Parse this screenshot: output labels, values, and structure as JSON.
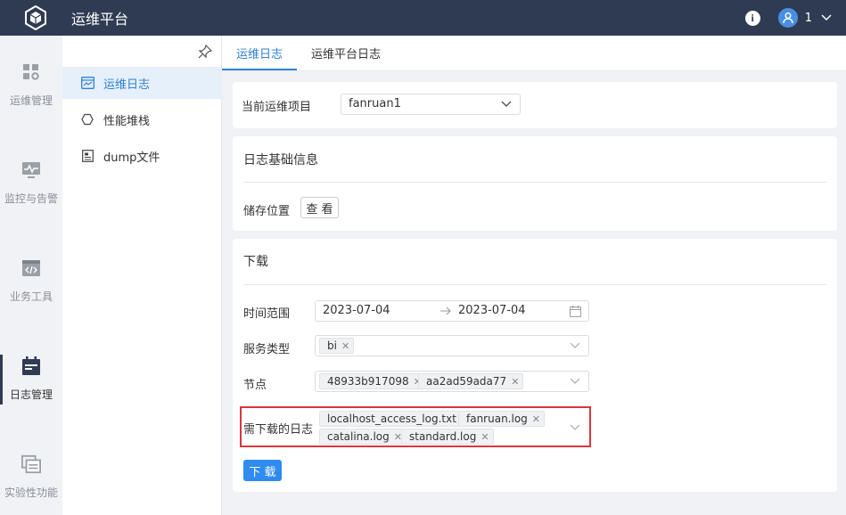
{
  "header": {
    "title": "运维平台",
    "user": "1"
  },
  "rail": {
    "items": [
      {
        "label": "运维管理",
        "icon": "grid-gear-icon"
      },
      {
        "label": "监控与告警",
        "icon": "monitor-pulse-icon"
      },
      {
        "label": "业务工具",
        "icon": "code-window-icon"
      },
      {
        "label": "日志管理",
        "icon": "calendar-log-icon",
        "active": true
      },
      {
        "label": "实验性功能",
        "icon": "window-list-icon"
      }
    ]
  },
  "subnav": {
    "items": [
      {
        "label": "运维日志",
        "icon": "chart-window-icon",
        "active": true
      },
      {
        "label": "性能堆栈",
        "icon": "hexagon-icon"
      },
      {
        "label": "dump文件",
        "icon": "document-icon"
      }
    ]
  },
  "tabs": [
    {
      "label": "运维日志",
      "active": true
    },
    {
      "label": "运维平台日志"
    }
  ],
  "project": {
    "label": "当前运维项目",
    "value": "fanruan1"
  },
  "basic_info": {
    "title": "日志基础信息",
    "storage_label": "储存位置",
    "view_button": "查 看"
  },
  "download": {
    "title": "下载",
    "time_range_label": "时间范围",
    "start_date": "2023-07-04",
    "end_date": "2023-07-04",
    "service_type_label": "服务类型",
    "service_tags": [
      "bi"
    ],
    "node_label": "节点",
    "node_tags": [
      "48933b917098",
      "aa2ad59ada77"
    ],
    "logs_label": "需下载的日志",
    "log_tags": [
      "localhost_access_log.txt",
      "fanruan.log",
      "catalina.log",
      "standard.log"
    ],
    "download_button": "下 载"
  },
  "colors": {
    "header_bg": "#2f3b52",
    "accent": "#2f7fd6",
    "primary_button": "#2f8bf0",
    "highlight_border": "#d9363e"
  }
}
